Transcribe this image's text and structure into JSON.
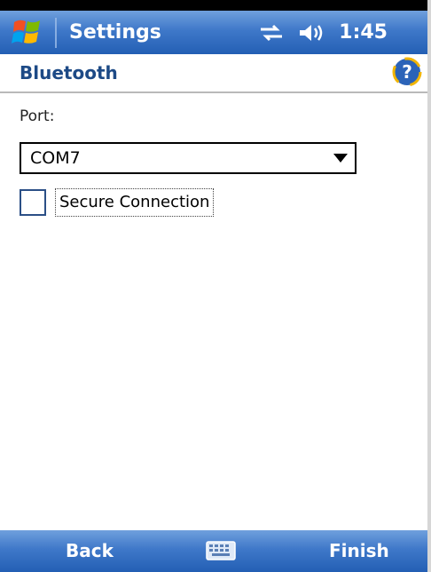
{
  "titlebar": {
    "app_title": "Settings",
    "start_icon": "windows-flag-icon",
    "status_icons": [
      "connectivity-icon",
      "volume-icon"
    ],
    "clock": "1:45"
  },
  "header": {
    "title": "Bluetooth",
    "help_icon": "help-icon"
  },
  "form": {
    "port_label": "Port:",
    "port_value": "COM7",
    "secure_label": "Secure Connection",
    "secure_checked": false
  },
  "menubar": {
    "left": "Back",
    "right": "Finish",
    "keyboard_icon": "keyboard-icon"
  },
  "colors": {
    "bar_blue": "#3f78c9",
    "header_text": "#1d4a86"
  }
}
